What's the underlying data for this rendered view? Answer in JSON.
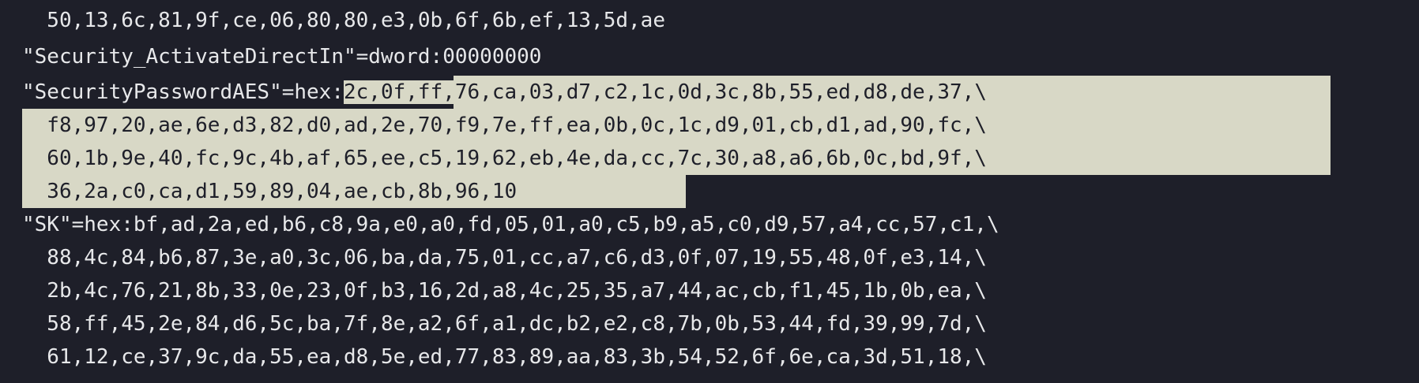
{
  "lines": [
    {
      "text": "  50,13,6c,81,9f,ce,06,80,80,e3,0b,6f,6b,ef,13,5d,ae"
    },
    {
      "text": "\"Security_ActivateDirectIn\"=dword:00000000"
    },
    {
      "pre": "\"SecurityPasswordAES\"=hex:",
      "sel": "2c,0f,ff,76,ca,03,d7,c2,1c,0d,3c,8b,55,ed,d8,de,37,\\"
    },
    {
      "sel": "  f8,97,20,ae,6e,d3,82,d0,ad,2e,70,f9,7e,ff,ea,0b,0c,1c,d9,01,cb,d1,ad,90,fc,\\"
    },
    {
      "sel": "  60,1b,9e,40,fc,9c,4b,af,65,ee,c5,19,62,eb,4e,da,cc,7c,30,a8,a6,6b,0c,bd,9f,\\"
    },
    {
      "sel": "  36,2a,c0,ca,d1,59,89,04,ae,cb,8b,96,10"
    },
    {
      "text": "\"SK\"=hex:bf,ad,2a,ed,b6,c8,9a,e0,a0,fd,05,01,a0,c5,b9,a5,c0,d9,57,a4,cc,57,c1,\\"
    },
    {
      "text": "  88,4c,84,b6,87,3e,a0,3c,06,ba,da,75,01,cc,a7,c6,d3,0f,07,19,55,48,0f,e3,14,\\"
    },
    {
      "text": "  2b,4c,76,21,8b,33,0e,23,0f,b3,16,2d,a8,4c,25,35,a7,44,ac,cb,f1,45,1b,0b,ea,\\"
    },
    {
      "text": "  58,ff,45,2e,84,d6,5c,ba,7f,8e,a2,6f,a1,dc,b2,e2,c8,7b,0b,53,44,fd,39,99,7d,\\"
    },
    {
      "text": "  61,12,ce,37,9c,da,55,ea,d8,5e,ed,77,83,89,aa,83,3b,54,52,6f,6e,ca,3d,51,18,\\"
    }
  ]
}
